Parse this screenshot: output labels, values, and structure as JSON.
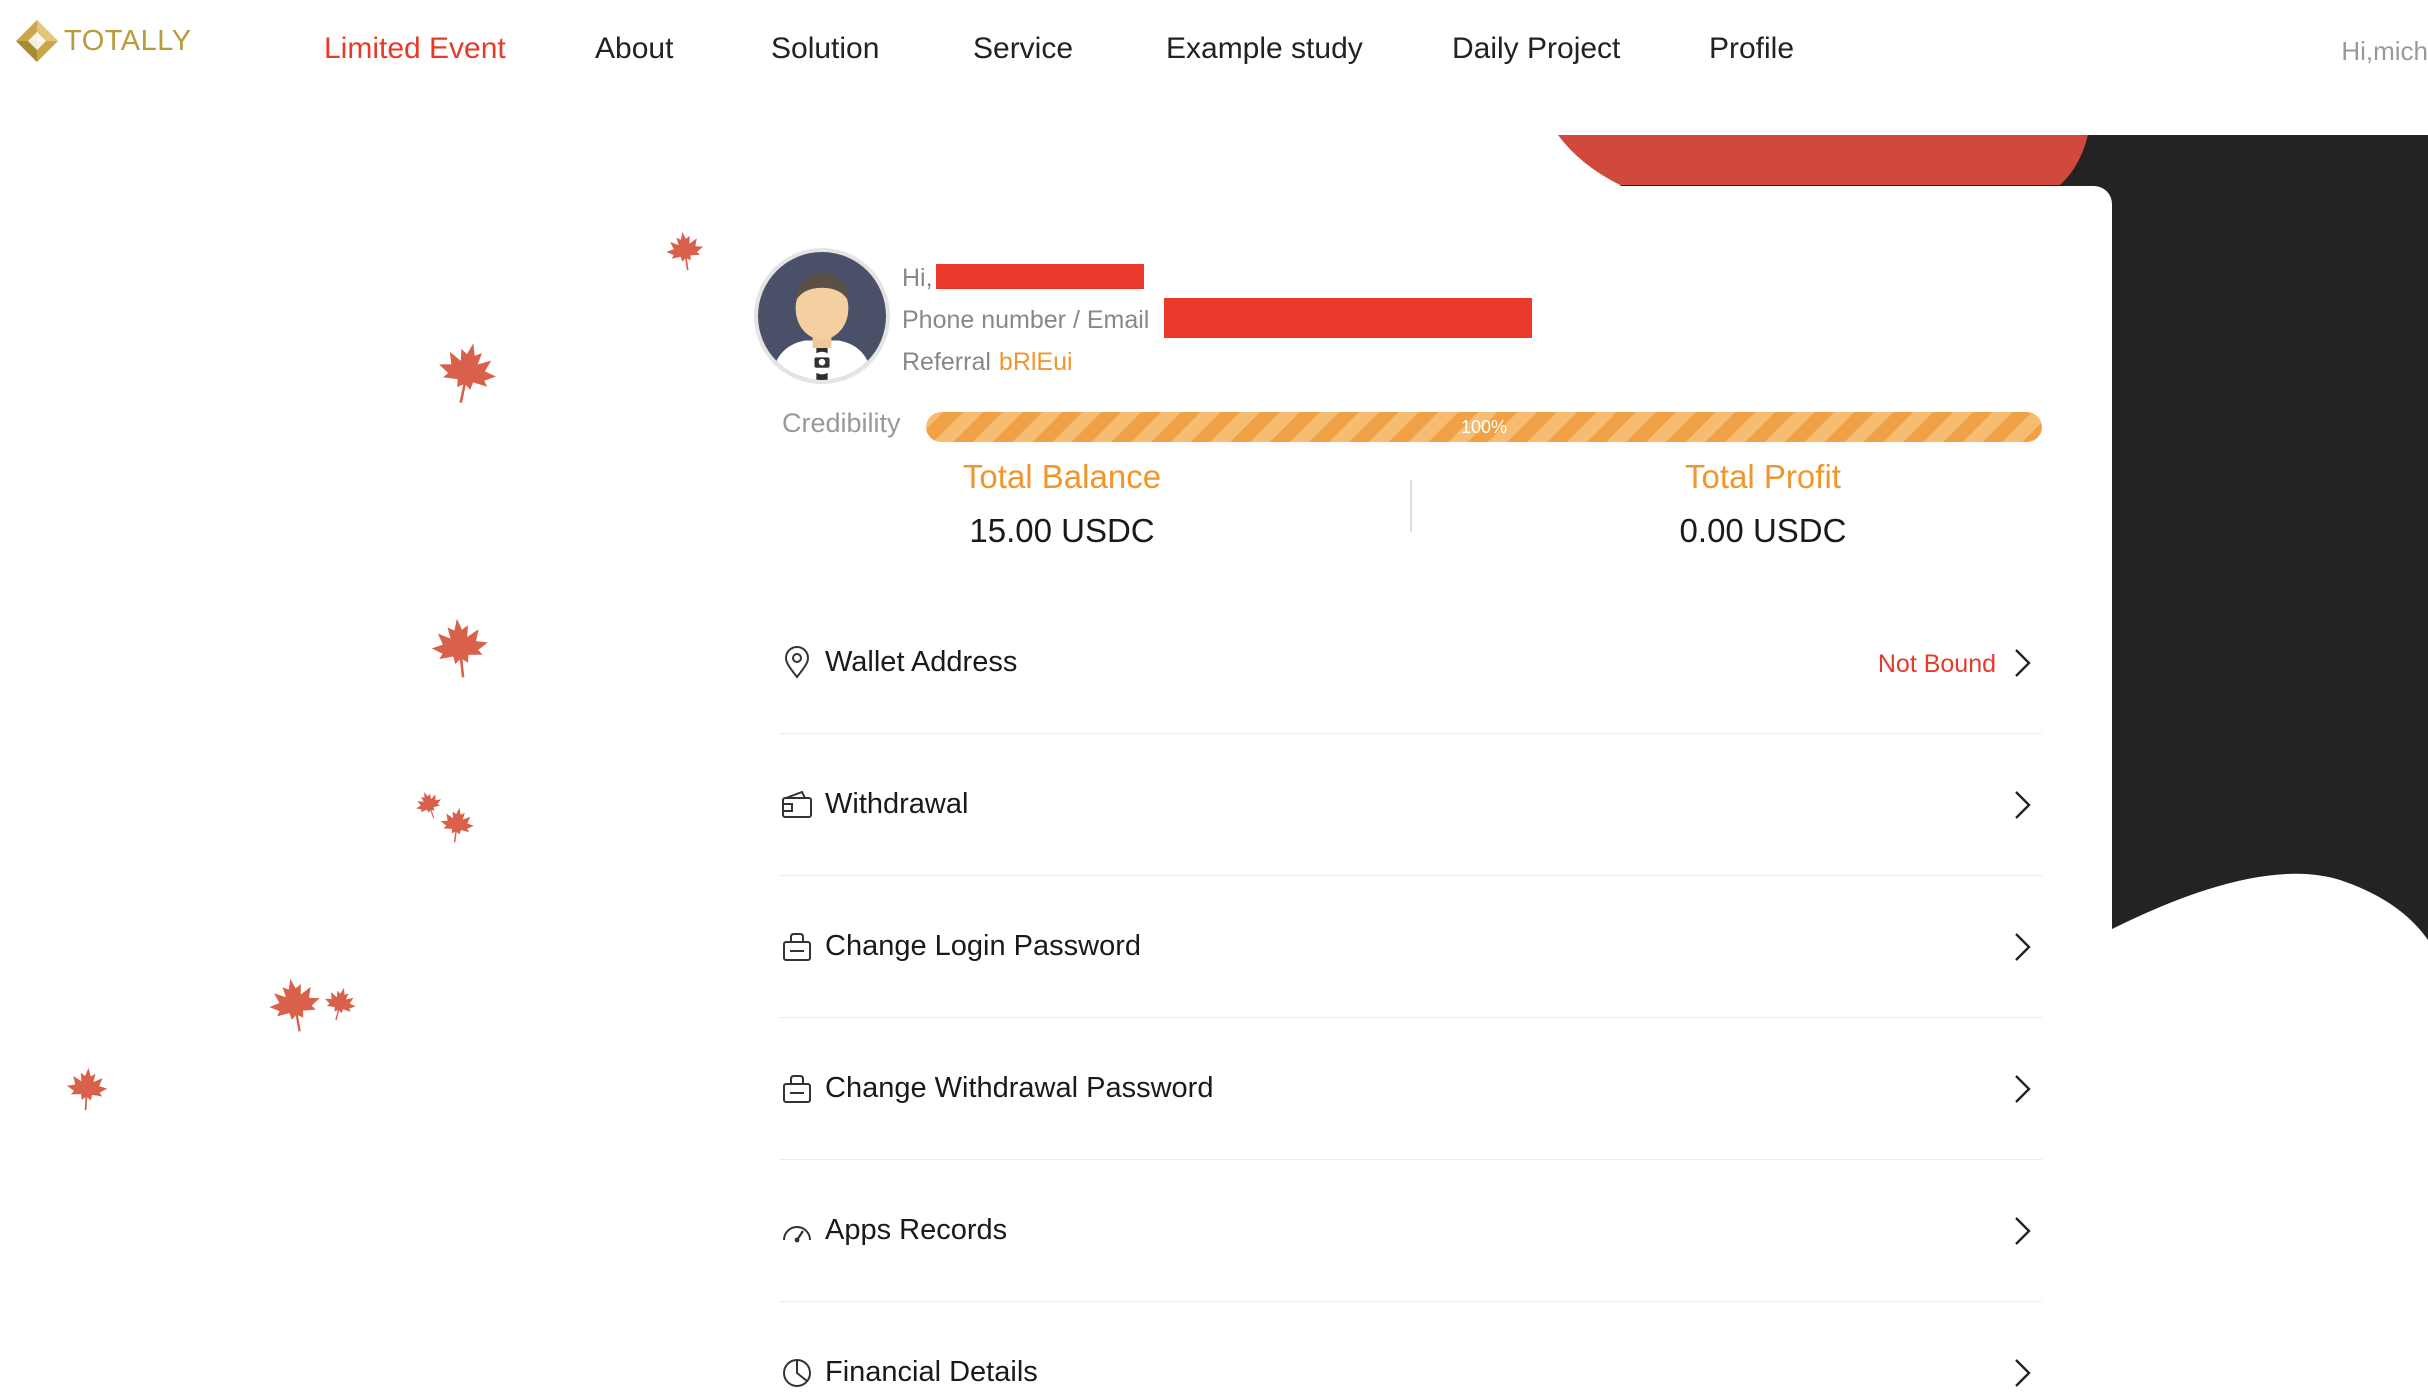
{
  "brand": {
    "name": "TOTALLY"
  },
  "nav": {
    "items": [
      {
        "label": "Limited Event",
        "active": true
      },
      {
        "label": "About"
      },
      {
        "label": "Solution"
      },
      {
        "label": "Service"
      },
      {
        "label": "Example study"
      },
      {
        "label": "Daily Project"
      },
      {
        "label": "Profile"
      }
    ],
    "greeting": "Hi,mich"
  },
  "profile": {
    "hi_label": "Hi,",
    "contact_label": "Phone number / Email",
    "referral_label": "Referral",
    "referral_code": "bRlEui"
  },
  "credibility": {
    "label": "Credibility",
    "percent": 100,
    "text": "100%"
  },
  "stats": {
    "balance": {
      "label": "Total Balance",
      "value": "15.00 USDC"
    },
    "profit": {
      "label": "Total Profit",
      "value": "0.00 USDC"
    }
  },
  "menu": [
    {
      "label": "Wallet Address",
      "status": "Not Bound",
      "icon": "location-pin-icon"
    },
    {
      "label": "Withdrawal",
      "icon": "wallet-icon"
    },
    {
      "label": "Change Login Password",
      "icon": "lock-icon"
    },
    {
      "label": "Change Withdrawal Password",
      "icon": "lock-icon"
    },
    {
      "label": "Apps Records",
      "icon": "speedometer-icon"
    },
    {
      "label": "Financial Details",
      "icon": "pie-chart-icon"
    }
  ],
  "colors": {
    "accent_red": "#e63a2a",
    "accent_orange": "#f0962b",
    "brand_gold": "#b99a3c",
    "decor_dark": "#232323",
    "leaf": "#d9604a"
  }
}
